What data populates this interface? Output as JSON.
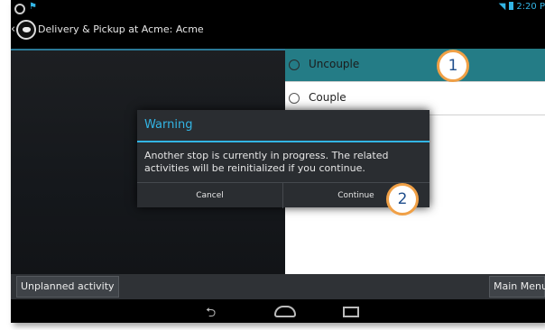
{
  "status_bar": {
    "time": "2:20 P"
  },
  "action_bar": {
    "title": "Delivery & Pickup at Acme: Acme"
  },
  "options": [
    {
      "label": "Uncouple",
      "selected": true
    },
    {
      "label": "Couple",
      "selected": false
    }
  ],
  "dialog": {
    "title": "Warning",
    "message": "Another stop is currently in progress. The related activities will be reinitialized if you continue.",
    "cancel_label": "Cancel",
    "continue_label": "Continue"
  },
  "bottom_bar": {
    "unplanned_label": "Unplanned activity",
    "main_menu_label": "Main Menu"
  },
  "callouts": [
    "1",
    "2"
  ],
  "colors": {
    "accent": "#33b5e5",
    "selected_row": "#247c86",
    "callout_border": "#f0a046",
    "callout_text": "#1f4e8c"
  },
  "icons": [
    "back-icon",
    "home-icon",
    "recent-apps-icon",
    "wifi-icon",
    "battery-icon",
    "notification-flag-icon",
    "app-logo-icon"
  ]
}
